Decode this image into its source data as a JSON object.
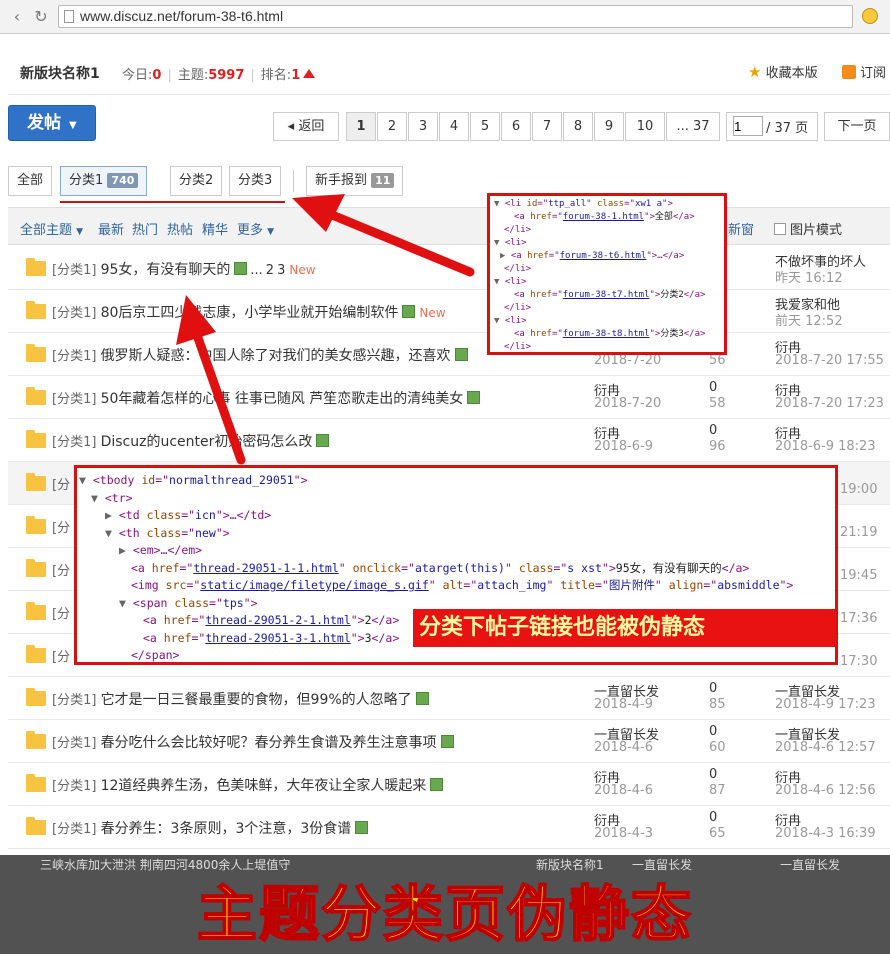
{
  "browser": {
    "url": "www.discuz.net/forum-38-t6.html"
  },
  "forum": {
    "name": "新版块名称1",
    "today_label": "今日:",
    "today_value": "0",
    "topics_label": "主题:",
    "topics_value": "5997",
    "rank_label": "排名:",
    "rank_value": "1",
    "favorite": "收藏本版",
    "subscribe": "订阅"
  },
  "post_button": "发帖",
  "pagination": {
    "back": "返回",
    "pages": [
      "1",
      "2",
      "3",
      "4",
      "5",
      "6",
      "7",
      "8",
      "9",
      "10",
      "... 37"
    ],
    "current": "1",
    "input_value": "1",
    "total": "/ 37 页",
    "next": "下一页"
  },
  "type_tabs": {
    "all": "全部",
    "cat1": "分类1",
    "cat1_count": "740",
    "cat2": "分类2",
    "cat3": "分类3",
    "newbie": "新手报到",
    "newbie_count": "11"
  },
  "filter": {
    "all_topics": "全部主题",
    "latest": "最新",
    "hot": "热门",
    "hot_posts": "热帖",
    "digest": "精华",
    "more": "更多",
    "new_window": "新窗",
    "image_mode": "图片模式"
  },
  "threads": [
    {
      "cat": "[分类1]",
      "title": "95女，有没有聊天的",
      "pages": [
        "2",
        "3"
      ],
      "ellipsis": "...",
      "new": "New",
      "author": "",
      "date": "",
      "replies": "",
      "views": "",
      "last_user": "不做坏事的坏人",
      "last_time": "昨天 16:12"
    },
    {
      "cat": "[分类1]",
      "title": "80后京",
      "title_tail": "工四少戴志康，小学毕业就开始编制软件",
      "new": "New",
      "last_user": "我爱家和他",
      "last_time": "前天 12:52"
    },
    {
      "cat": "[分类1]",
      "title": "俄罗斯人疑惑：中国人除了对我们的美女感兴趣，还喜欢",
      "date": "2018-7-20",
      "views": "56",
      "last_user": "衍冉",
      "last_time": "2018-7-20 17:55"
    },
    {
      "cat": "[分类1]",
      "title": "50年藏着怎样的心事 往事已随风 芦笙恋歌走出的清纯美女",
      "author": "衍冉",
      "date": "2018-7-20",
      "replies": "0",
      "views": "58",
      "last_user": "衍冉",
      "last_time": "2018-7-20 17:23"
    },
    {
      "cat": "[分类1]",
      "title": "Discuz的ucenter初始密码怎么改",
      "author": "衍冉",
      "date": "2018-6-9",
      "replies": "0",
      "views": "96",
      "last_user": "衍冉",
      "last_time": "2018-6-9 18:23"
    },
    {
      "cat": "[分",
      "last_time_tail": "19:00"
    },
    {
      "cat": "[分",
      "last_time_tail": "21:19"
    },
    {
      "cat": "[分",
      "last_time_tail": "19:45"
    },
    {
      "cat": "[分",
      "last_time_tail": "17:36"
    },
    {
      "cat": "[分",
      "last_time_tail": "17:30"
    },
    {
      "cat": "[分类1]",
      "title": "它才是一日三餐最重要的食物，但99%的人忽略了",
      "author": "一直留长发",
      "date": "2018-4-9",
      "replies": "0",
      "views": "85",
      "last_user": "一直留长发",
      "last_time": "2018-4-9 17:23"
    },
    {
      "cat": "[分类1]",
      "title": "春分吃什么会比较好呢？春分养生食谱及养生注意事项",
      "author": "一直留长发",
      "date": "2018-4-6",
      "replies": "0",
      "views": "60",
      "last_user": "一直留长发",
      "last_time": "2018-4-6 12:57"
    },
    {
      "cat": "[分类1]",
      "title": "12道经典养生汤，色美味鲜，大年夜让全家人暖起来",
      "author": "衍冉",
      "date": "2018-4-6",
      "replies": "0",
      "views": "87",
      "last_user": "衍冉",
      "last_time": "2018-4-6 12:56"
    },
    {
      "cat": "[分类1]",
      "title": "春分养生：3条原则，3个注意，3份食谱",
      "author": "衍冉",
      "date": "2018-4-3",
      "replies": "0",
      "views": "65",
      "last_user": "衍冉",
      "last_time": "2018-4-3 16:39"
    }
  ],
  "code_top": {
    "lines": [
      {
        "tri": "▼",
        "parts": [
          [
            "tg",
            "<li "
          ],
          [
            "an",
            "id"
          ],
          [
            "tg",
            "=\""
          ],
          [
            "av",
            "ttp_all"
          ],
          [
            "tg",
            "\" "
          ],
          [
            "an",
            "class"
          ],
          [
            "tg",
            "=\""
          ],
          [
            "av",
            "xw1 a"
          ],
          [
            "tg",
            "\">"
          ]
        ]
      },
      {
        "parts": [
          [
            "tg",
            "<a "
          ],
          [
            "an",
            "href"
          ],
          [
            "tg",
            "=\""
          ],
          [
            "lk",
            "forum-38-1.html"
          ],
          [
            "tg",
            "\">"
          ],
          [
            "tx",
            "全部"
          ],
          [
            "tg",
            "</a>"
          ]
        ]
      },
      {
        "parts": [
          [
            "tg",
            "</li>"
          ]
        ]
      },
      {
        "tri": "▼",
        "parts": [
          [
            "tg",
            "<li>"
          ]
        ]
      },
      {
        "tri": "▶",
        "parts": [
          [
            "tg",
            "<a "
          ],
          [
            "an",
            "href"
          ],
          [
            "tg",
            "=\""
          ],
          [
            "lk",
            "forum-38-t6.html"
          ],
          [
            "tg",
            "\">…</a>"
          ]
        ]
      },
      {
        "parts": [
          [
            "tg",
            "</li>"
          ]
        ]
      },
      {
        "tri": "▼",
        "parts": [
          [
            "tg",
            "<li>"
          ]
        ]
      },
      {
        "parts": [
          [
            "tg",
            "<a "
          ],
          [
            "an",
            "href"
          ],
          [
            "tg",
            "=\""
          ],
          [
            "lk",
            "forum-38-t7.html"
          ],
          [
            "tg",
            "\">"
          ],
          [
            "tx",
            "分类2"
          ],
          [
            "tg",
            "</a>"
          ]
        ]
      },
      {
        "parts": [
          [
            "tg",
            "</li>"
          ]
        ]
      },
      {
        "tri": "▼",
        "parts": [
          [
            "tg",
            "<li>"
          ]
        ]
      },
      {
        "parts": [
          [
            "tg",
            "<a "
          ],
          [
            "an",
            "href"
          ],
          [
            "tg",
            "=\""
          ],
          [
            "lk",
            "forum-38-t8.html"
          ],
          [
            "tg",
            "\">"
          ],
          [
            "tx",
            "分类3"
          ],
          [
            "tg",
            "</a>"
          ]
        ]
      },
      {
        "parts": [
          [
            "tg",
            "</li>"
          ]
        ]
      }
    ]
  },
  "code_bottom": {
    "lines": [
      {
        "tri": "▼",
        "parts": [
          [
            "tg",
            "<tbody "
          ],
          [
            "an",
            "id"
          ],
          [
            "tg",
            "=\""
          ],
          [
            "av",
            "normalthread_29051"
          ],
          [
            "tg",
            "\">"
          ]
        ]
      },
      {
        "tri": "▼",
        "parts": [
          [
            "tg",
            "<tr>"
          ]
        ]
      },
      {
        "tri": "▶",
        "parts": [
          [
            "tg",
            "<td "
          ],
          [
            "an",
            "class"
          ],
          [
            "tg",
            "=\""
          ],
          [
            "av",
            "icn"
          ],
          [
            "tg",
            "\">…</td>"
          ]
        ]
      },
      {
        "tri": "▼",
        "parts": [
          [
            "tg",
            "<th "
          ],
          [
            "an",
            "class"
          ],
          [
            "tg",
            "=\""
          ],
          [
            "av",
            "new"
          ],
          [
            "tg",
            "\">"
          ]
        ]
      },
      {
        "tri": "▶",
        "parts": [
          [
            "tg",
            "<em>…</em>"
          ]
        ]
      },
      {
        "parts": [
          [
            "tg",
            "<a "
          ],
          [
            "an",
            "href"
          ],
          [
            "tg",
            "=\""
          ],
          [
            "lk",
            "thread-29051-1-1.html"
          ],
          [
            "tg",
            "\" "
          ],
          [
            "an",
            "onclick"
          ],
          [
            "tg",
            "=\""
          ],
          [
            "av",
            "atarget(this)"
          ],
          [
            "tg",
            "\" "
          ],
          [
            "an",
            "class"
          ],
          [
            "tg",
            "=\""
          ],
          [
            "av",
            "s xst"
          ],
          [
            "tg",
            "\">"
          ],
          [
            "tx",
            "95女，有没有聊天的"
          ],
          [
            "tg",
            "</a>"
          ]
        ]
      },
      {
        "parts": [
          [
            "tg",
            "<img "
          ],
          [
            "an",
            "src"
          ],
          [
            "tg",
            "=\""
          ],
          [
            "lk",
            "static/image/filetype/image_s.gif"
          ],
          [
            "tg",
            "\" "
          ],
          [
            "an",
            "alt"
          ],
          [
            "tg",
            "=\""
          ],
          [
            "av",
            "attach_img"
          ],
          [
            "tg",
            "\" "
          ],
          [
            "an",
            "title"
          ],
          [
            "tg",
            "=\""
          ],
          [
            "av",
            "图片附件"
          ],
          [
            "tg",
            "\" "
          ],
          [
            "an",
            "align"
          ],
          [
            "tg",
            "=\""
          ],
          [
            "av",
            "absmiddle"
          ],
          [
            "tg",
            "\">"
          ]
        ]
      },
      {
        "tri": "▼",
        "parts": [
          [
            "tg",
            "<span "
          ],
          [
            "an",
            "class"
          ],
          [
            "tg",
            "=\""
          ],
          [
            "av",
            "tps"
          ],
          [
            "tg",
            "\">"
          ]
        ]
      },
      {
        "parts": [
          [
            "tg",
            "<a "
          ],
          [
            "an",
            "href"
          ],
          [
            "tg",
            "=\""
          ],
          [
            "lk",
            "thread-29051-2-1.html"
          ],
          [
            "tg",
            "\">"
          ],
          [
            "tx",
            "2"
          ],
          [
            "tg",
            "</a>"
          ]
        ]
      },
      {
        "parts": [
          [
            "tg",
            "<a "
          ],
          [
            "an",
            "href"
          ],
          [
            "tg",
            "=\""
          ],
          [
            "lk",
            "thread-29051-3-1.html"
          ],
          [
            "tg",
            "\">"
          ],
          [
            "tx",
            "3"
          ],
          [
            "tg",
            "</a>"
          ]
        ]
      },
      {
        "parts": [
          [
            "tg",
            "</span>"
          ]
        ]
      }
    ]
  },
  "callout": "分类下帖子链接也能被伪静态",
  "banner": {
    "text": "主题分类页伪静态",
    "hidden_row": "三峡水库加大泄洪 荆南四河4800余人上堤值守",
    "hidden_author": "新版块名称1",
    "hidden_user": "一直留长发",
    "hidden_user2": "一直留长发"
  },
  "colors": {
    "accent": "#2f72c8",
    "red": "#e02020",
    "banner_text": "#ffe600"
  }
}
